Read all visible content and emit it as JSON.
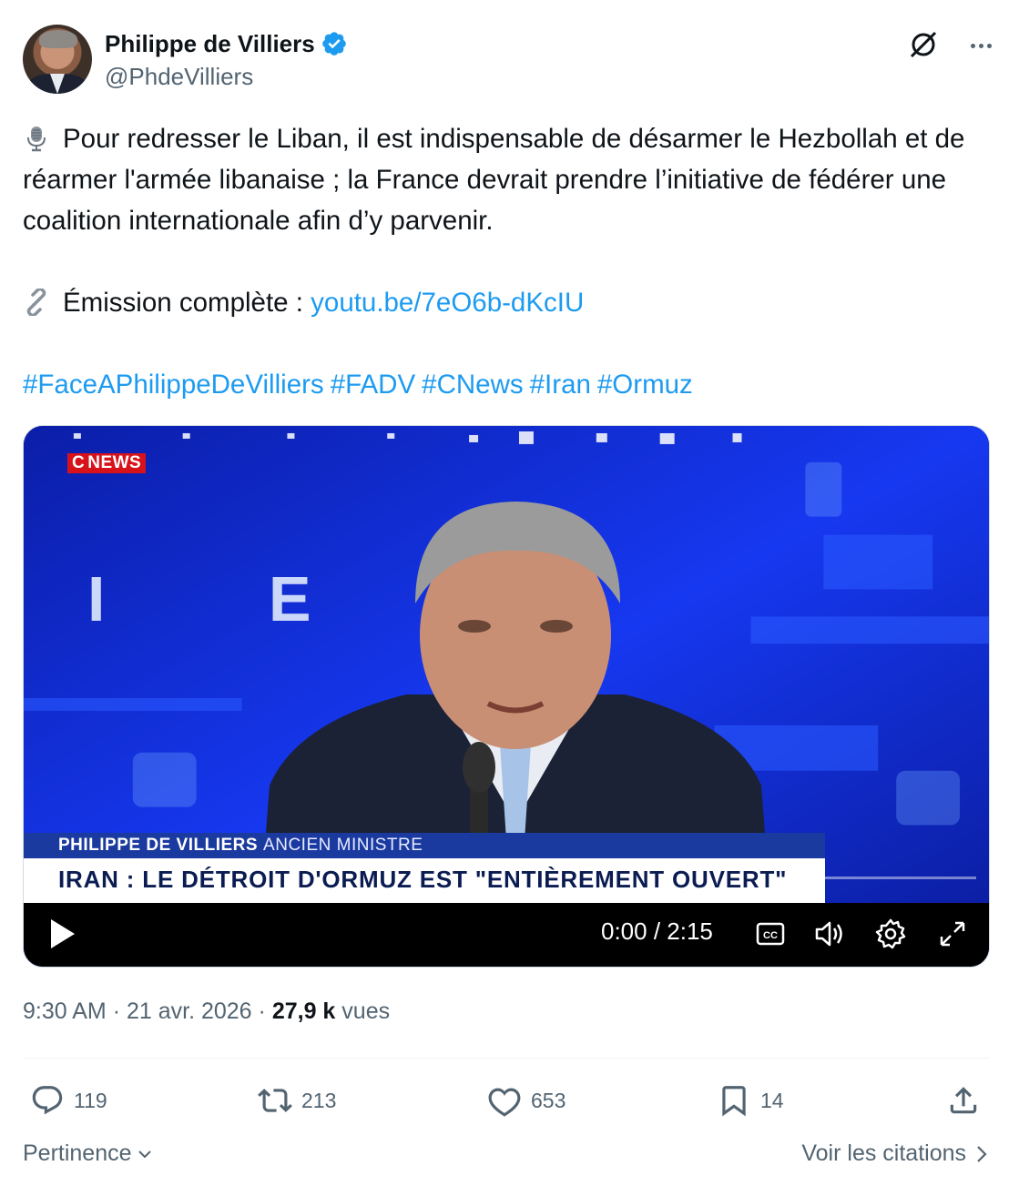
{
  "author": {
    "name": "Philippe de Villiers",
    "handle": "@PhdeVilliers",
    "verified": true
  },
  "tweet": {
    "line1": "Pour redresser le Liban, il est indispensable de désarmer le Hezbollah et de réarmer l'armée libanaise ; la France devrait prendre l’initiative de fédérer une coalition internationale afin d’y parvenir.",
    "line1_icon": "microphone-icon",
    "line2_prefix": "Émission complète : ",
    "line2_icon": "link-icon",
    "link": "youtu.be/7eO6b-dKcIU",
    "hashtags": [
      "#FaceAPhilippeDeVilliers",
      "#FADV",
      "#CNews",
      "#Iran",
      "#Ormuz"
    ]
  },
  "video": {
    "channel_logo": "NEWS",
    "background_letters": "I E R",
    "lower_third_name": "PHILIPPE DE VILLIERS",
    "lower_third_role": "ANCIEN MINISTRE",
    "headline": "IRAN : LE DÉTROIT D'ORMUZ EST \"ENTIÈREMENT OUVERT\"",
    "time": "0:00 / 2:15",
    "controls": [
      "play-icon",
      "captions-icon",
      "volume-icon",
      "settings-icon",
      "fullscreen-icon"
    ]
  },
  "meta": {
    "time": "9:30 AM",
    "date": "21 avr. 2026",
    "views_count": "27,9 k",
    "views_label": "vues",
    "separator": "·"
  },
  "actions": {
    "replies": "119",
    "reposts": "213",
    "likes": "653",
    "bookmarks": "14"
  },
  "footer": {
    "sort_label": "Pertinence",
    "quotes_label": "Voir les citations"
  },
  "colors": {
    "accent": "#1d9bf0",
    "text": "#0f1419",
    "secondary": "#536471",
    "verified": "#1d9bf0",
    "cnews_red": "#d8121b"
  }
}
